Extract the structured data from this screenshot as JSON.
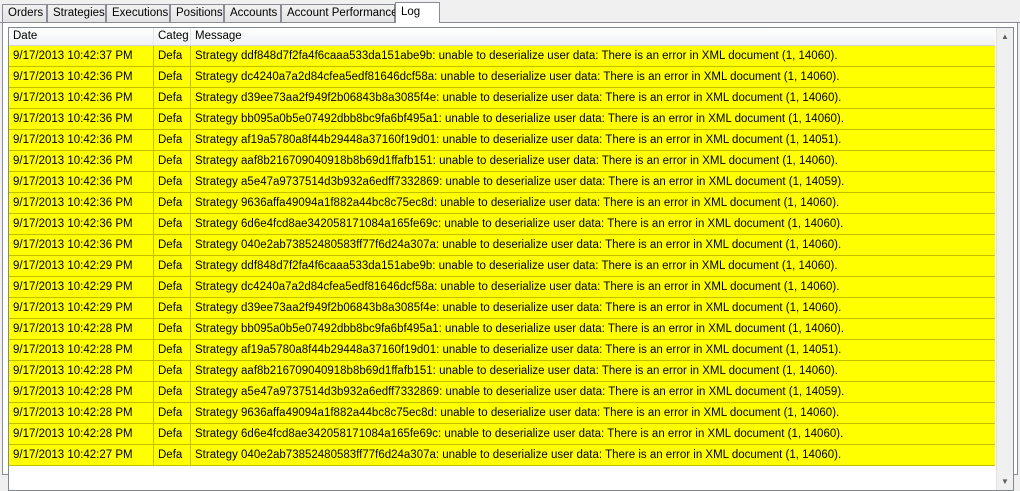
{
  "tabs": [
    {
      "label": "Orders"
    },
    {
      "label": "Strategies"
    },
    {
      "label": "Executions"
    },
    {
      "label": "Positions"
    },
    {
      "label": "Accounts"
    },
    {
      "label": "Account Performance"
    },
    {
      "label": "Log"
    }
  ],
  "active_tab": "Log",
  "log": {
    "columns": {
      "date": "Date",
      "category": "Categ",
      "message": "Message"
    },
    "row_color": "#ffff00",
    "rows": [
      {
        "date": "9/17/2013 10:42:37 PM",
        "category": "Defa",
        "message": "Strategy ddf848d7f2fa4f6caaa533da151abe9b: unable to deserialize user data: There is an error in XML document (1, 14060)."
      },
      {
        "date": "9/17/2013 10:42:36 PM",
        "category": "Defa",
        "message": "Strategy dc4240a7a2d84cfea5edf81646dcf58a: unable to deserialize user data: There is an error in XML document (1, 14060)."
      },
      {
        "date": "9/17/2013 10:42:36 PM",
        "category": "Defa",
        "message": "Strategy d39ee73aa2f949f2b06843b8a3085f4e: unable to deserialize user data: There is an error in XML document (1, 14060)."
      },
      {
        "date": "9/17/2013 10:42:36 PM",
        "category": "Defa",
        "message": "Strategy bb095a0b5e07492dbb8bc9fa6bf495a1: unable to deserialize user data: There is an error in XML document (1, 14060)."
      },
      {
        "date": "9/17/2013 10:42:36 PM",
        "category": "Defa",
        "message": "Strategy af19a5780a8f44b29448a37160f19d01: unable to deserialize user data: There is an error in XML document (1, 14051)."
      },
      {
        "date": "9/17/2013 10:42:36 PM",
        "category": "Defa",
        "message": "Strategy aaf8b216709040918b8b69d1ffafb151: unable to deserialize user data: There is an error in XML document (1, 14060)."
      },
      {
        "date": "9/17/2013 10:42:36 PM",
        "category": "Defa",
        "message": "Strategy a5e47a9737514d3b932a6edff7332869: unable to deserialize user data: There is an error in XML document (1, 14059)."
      },
      {
        "date": "9/17/2013 10:42:36 PM",
        "category": "Defa",
        "message": "Strategy 9636affa49094a1f882a44bc8c75ec8d: unable to deserialize user data: There is an error in XML document (1, 14060)."
      },
      {
        "date": "9/17/2013 10:42:36 PM",
        "category": "Defa",
        "message": "Strategy 6d6e4fcd8ae342058171084a165fe69c: unable to deserialize user data: There is an error in XML document (1, 14060)."
      },
      {
        "date": "9/17/2013 10:42:36 PM",
        "category": "Defa",
        "message": "Strategy 040e2ab73852480583ff77f6d24a307a: unable to deserialize user data: There is an error in XML document (1, 14060)."
      },
      {
        "date": "9/17/2013 10:42:29 PM",
        "category": "Defa",
        "message": "Strategy ddf848d7f2fa4f6caaa533da151abe9b: unable to deserialize user data: There is an error in XML document (1, 14060)."
      },
      {
        "date": "9/17/2013 10:42:29 PM",
        "category": "Defa",
        "message": "Strategy dc4240a7a2d84cfea5edf81646dcf58a: unable to deserialize user data: There is an error in XML document (1, 14060)."
      },
      {
        "date": "9/17/2013 10:42:29 PM",
        "category": "Defa",
        "message": "Strategy d39ee73aa2f949f2b06843b8a3085f4e: unable to deserialize user data: There is an error in XML document (1, 14060)."
      },
      {
        "date": "9/17/2013 10:42:28 PM",
        "category": "Defa",
        "message": "Strategy bb095a0b5e07492dbb8bc9fa6bf495a1: unable to deserialize user data: There is an error in XML document (1, 14060)."
      },
      {
        "date": "9/17/2013 10:42:28 PM",
        "category": "Defa",
        "message": "Strategy af19a5780a8f44b29448a37160f19d01: unable to deserialize user data: There is an error in XML document (1, 14051)."
      },
      {
        "date": "9/17/2013 10:42:28 PM",
        "category": "Defa",
        "message": "Strategy aaf8b216709040918b8b69d1ffafb151: unable to deserialize user data: There is an error in XML document (1, 14060)."
      },
      {
        "date": "9/17/2013 10:42:28 PM",
        "category": "Defa",
        "message": "Strategy a5e47a9737514d3b932a6edff7332869: unable to deserialize user data: There is an error in XML document (1, 14059)."
      },
      {
        "date": "9/17/2013 10:42:28 PM",
        "category": "Defa",
        "message": "Strategy 9636affa49094a1f882a44bc8c75ec8d: unable to deserialize user data: There is an error in XML document (1, 14060)."
      },
      {
        "date": "9/17/2013 10:42:28 PM",
        "category": "Defa",
        "message": "Strategy 6d6e4fcd8ae342058171084a165fe69c: unable to deserialize user data: There is an error in XML document (1, 14060)."
      },
      {
        "date": "9/17/2013 10:42:27 PM",
        "category": "Defa",
        "message": "Strategy 040e2ab73852480583ff77f6d24a307a: unable to deserialize user data: There is an error in XML document (1, 14060)."
      }
    ]
  },
  "scrollbar": {
    "up_icon": "arrow-up-icon",
    "down_icon": "arrow-down-icon"
  }
}
